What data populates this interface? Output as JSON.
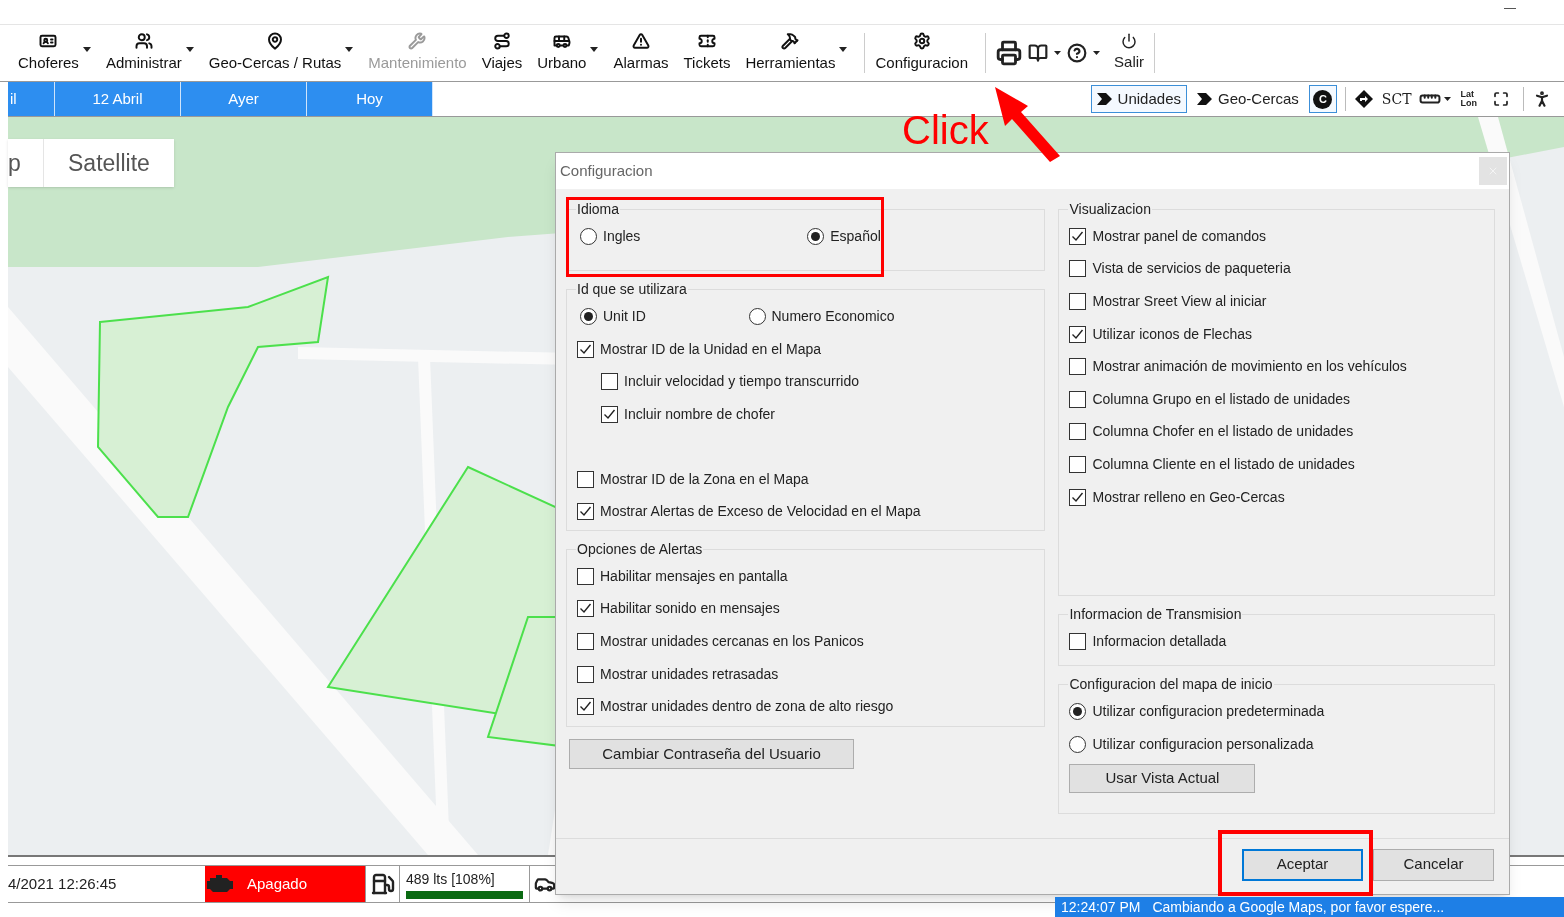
{
  "toolbar": {
    "items": [
      {
        "label": "Choferes",
        "dropdown": true,
        "disabled": false
      },
      {
        "label": "Administrar",
        "dropdown": true,
        "disabled": false
      },
      {
        "label": "Geo-Cercas / Rutas",
        "dropdown": true,
        "disabled": false
      },
      {
        "label": "Mantenimiento",
        "dropdown": false,
        "disabled": true
      },
      {
        "label": "Viajes",
        "dropdown": false,
        "disabled": false
      },
      {
        "label": "Urbano",
        "dropdown": true,
        "disabled": false
      },
      {
        "label": "Alarmas",
        "dropdown": false,
        "disabled": false
      },
      {
        "label": "Tickets",
        "dropdown": false,
        "disabled": false
      },
      {
        "label": "Herramientas",
        "dropdown": true,
        "disabled": false
      },
      {
        "label": "Configuracion",
        "dropdown": false,
        "disabled": false
      }
    ],
    "exit_label": "Salir"
  },
  "date_tabs": [
    "il",
    "12 Abril",
    "Ayer",
    "Hoy"
  ],
  "map_toggles": [
    {
      "label": "Unidades",
      "selected": true,
      "kind": "layer"
    },
    {
      "label": "Geo-Cercas",
      "selected": false,
      "kind": "layer"
    },
    {
      "label": "C",
      "selected": true,
      "kind": "badge"
    }
  ],
  "map_tools": {
    "sct": "SCT",
    "lat": "Lat",
    "lon": "Lon"
  },
  "map_types": [
    "p",
    "Satellite"
  ],
  "annotation": {
    "text": "Click"
  },
  "dialog": {
    "title": "Configuracion",
    "idioma": {
      "legend": "Idioma",
      "options": [
        {
          "label": "Ingles",
          "selected": false
        },
        {
          "label": "Español",
          "selected": true
        }
      ]
    },
    "id_group": {
      "legend": "Id que se utilizara",
      "options": [
        {
          "label": "Unit ID",
          "selected": true
        },
        {
          "label": "Numero Economico",
          "selected": false
        }
      ],
      "checks": [
        {
          "label": "Mostrar ID de la Unidad en el Mapa",
          "checked": true,
          "children": [
            {
              "label": "Incluir velocidad y tiempo transcurrido",
              "checked": false
            },
            {
              "label": "Incluir nombre de chofer",
              "checked": true
            }
          ]
        },
        {
          "label": "Mostrar ID de la Zona en el Mapa",
          "checked": false
        },
        {
          "label": "Mostrar Alertas de Exceso de Velocidad en el Mapa",
          "checked": true
        }
      ]
    },
    "alertas": {
      "legend": "Opciones de Alertas",
      "checks": [
        {
          "label": "Habilitar mensajes en pantalla",
          "checked": false
        },
        {
          "label": "Habilitar sonido en mensajes",
          "checked": true
        },
        {
          "label": "Mostrar unidades cercanas en los Panicos",
          "checked": false
        },
        {
          "label": "Mostrar unidades retrasadas",
          "checked": false
        },
        {
          "label": "Mostrar unidades dentro de zona de alto riesgo",
          "checked": true
        }
      ]
    },
    "password_button": "Cambiar Contraseña del Usuario",
    "visualizacion": {
      "legend": "Visualizacion",
      "checks": [
        {
          "label": "Mostrar panel de comandos",
          "checked": true
        },
        {
          "label": "Vista de servicios de paqueteria",
          "checked": false
        },
        {
          "label": "Mostrar Sreet View al iniciar",
          "checked": false
        },
        {
          "label": "Utilizar iconos de Flechas",
          "checked": true
        },
        {
          "label": "Mostrar animación de movimiento en los vehículos",
          "checked": false
        },
        {
          "label": "Columna Grupo en el listado de unidades",
          "checked": false
        },
        {
          "label": "Columna Chofer en el listado de unidades",
          "checked": false
        },
        {
          "label": "Columna Cliente en el listado de unidades",
          "checked": false
        },
        {
          "label": "Mostrar relleno en Geo-Cercas",
          "checked": true
        }
      ]
    },
    "transmision": {
      "legend": "Informacion de Transmision",
      "checks": [
        {
          "label": "Informacion detallada",
          "checked": false
        }
      ]
    },
    "mapa_inicio": {
      "legend": "Configuracion del mapa de inicio",
      "options": [
        {
          "label": "Utilizar configuracion predeterminada",
          "selected": true
        },
        {
          "label": "Utilizar configuracion personalizada",
          "selected": false
        }
      ],
      "button": "Usar Vista Actual"
    },
    "buttons": [
      {
        "label": "Aceptar",
        "default": true
      },
      {
        "label": "Cancelar",
        "default": false
      }
    ]
  },
  "unit_row": {
    "time": "4/2021 12:26:45",
    "engine": "Apagado",
    "fuel": "489 lts [108%]",
    "level": 1
  },
  "status_bar": {
    "time": "12:24:07 PM",
    "message": "Cambiando a Google Maps, por favor espere..."
  }
}
